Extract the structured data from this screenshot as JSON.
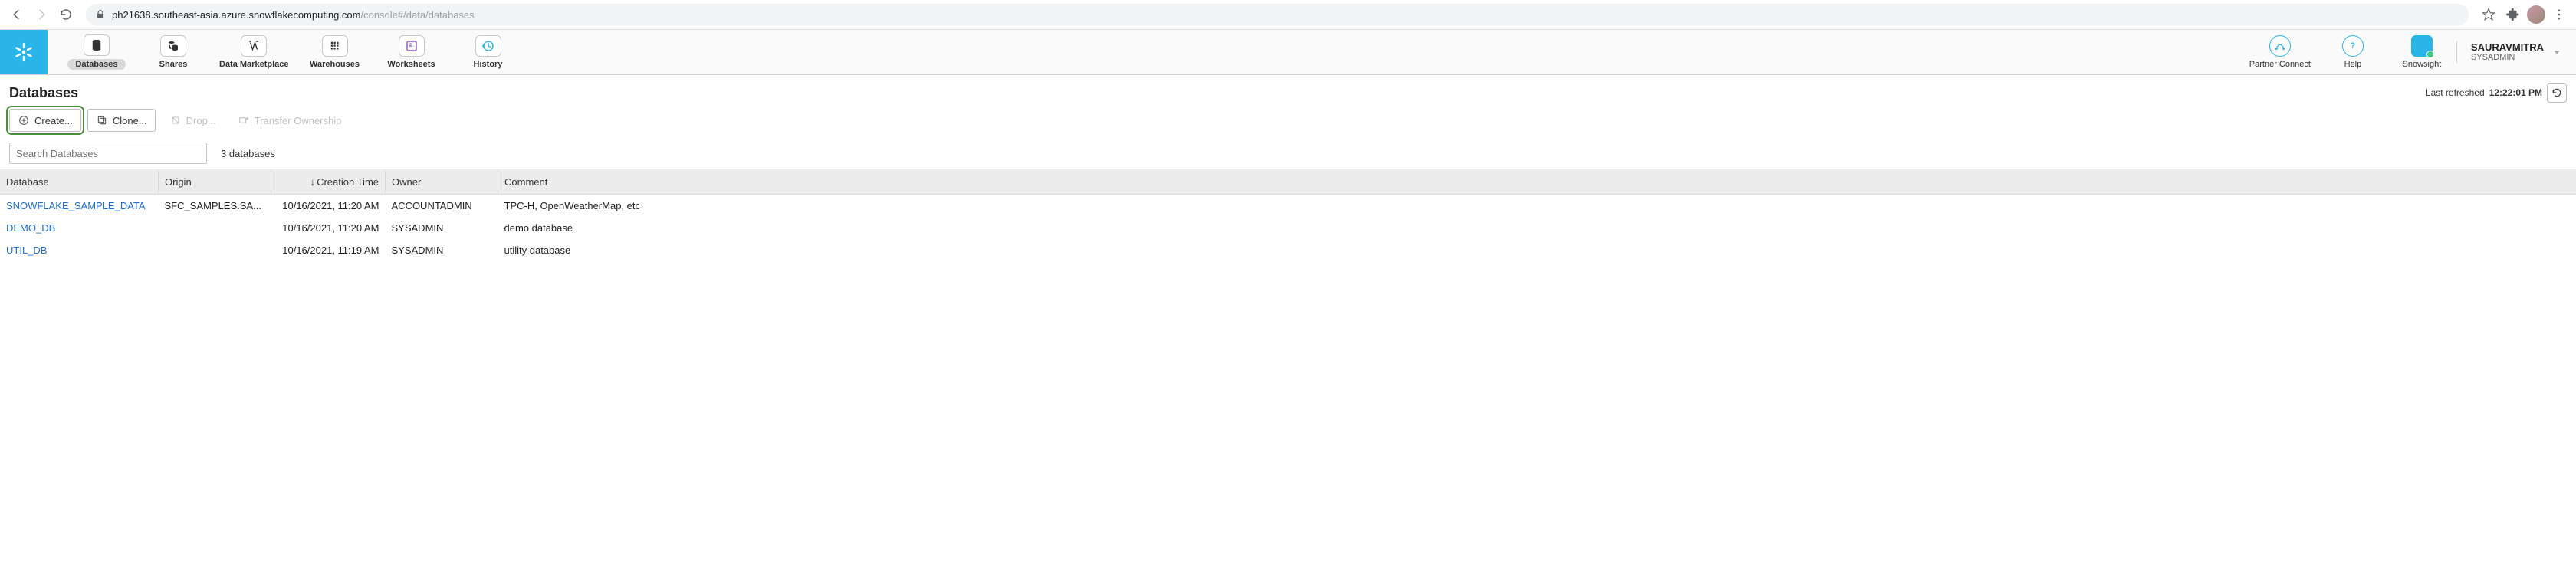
{
  "browser": {
    "url_host": "ph21638.southeast-asia.azure.snowflakecomputing.com",
    "url_path": "/console#/data/databases"
  },
  "nav": {
    "databases": "Databases",
    "shares": "Shares",
    "data_marketplace": "Data Marketplace",
    "warehouses": "Warehouses",
    "worksheets": "Worksheets",
    "history": "History",
    "partner_connect": "Partner Connect",
    "help": "Help",
    "snowsight": "Snowsight"
  },
  "account": {
    "name": "SAURAVMITRA",
    "role": "SYSADMIN"
  },
  "page": {
    "title": "Databases",
    "last_refreshed_label": "Last refreshed",
    "last_refreshed_time": "12:22:01 PM"
  },
  "actions": {
    "create": "Create...",
    "clone": "Clone...",
    "drop": "Drop...",
    "transfer": "Transfer Ownership"
  },
  "search": {
    "placeholder": "Search Databases",
    "count": "3 databases"
  },
  "table": {
    "col_database": "Database",
    "col_origin": "Origin",
    "col_creation": "Creation Time",
    "col_owner": "Owner",
    "col_comment": "Comment",
    "rows": [
      {
        "database": "SNOWFLAKE_SAMPLE_DATA",
        "origin": "SFC_SAMPLES.SA...",
        "creation": "10/16/2021, 11:20 AM",
        "owner": "ACCOUNTADMIN",
        "comment": "TPC-H, OpenWeatherMap, etc"
      },
      {
        "database": "DEMO_DB",
        "origin": "",
        "creation": "10/16/2021, 11:20 AM",
        "owner": "SYSADMIN",
        "comment": "demo database"
      },
      {
        "database": "UTIL_DB",
        "origin": "",
        "creation": "10/16/2021, 11:19 AM",
        "owner": "SYSADMIN",
        "comment": "utility database"
      }
    ]
  }
}
